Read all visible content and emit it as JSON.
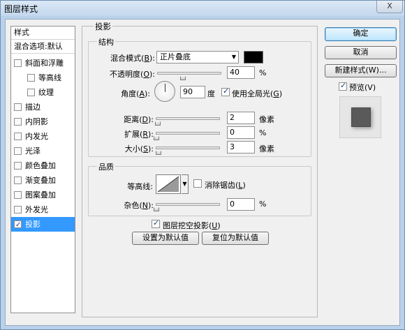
{
  "window": {
    "title": "图层样式",
    "close_label": "X"
  },
  "style_list": {
    "header": "样式",
    "blend_options": "混合选项:默认",
    "items": [
      {
        "label": "斜面和浮雕",
        "checked": false,
        "sub": false
      },
      {
        "label": "等高线",
        "checked": false,
        "sub": true
      },
      {
        "label": "纹理",
        "checked": false,
        "sub": true
      },
      {
        "label": "描边",
        "checked": false,
        "sub": false
      },
      {
        "label": "内阴影",
        "checked": false,
        "sub": false
      },
      {
        "label": "内发光",
        "checked": false,
        "sub": false
      },
      {
        "label": "光泽",
        "checked": false,
        "sub": false
      },
      {
        "label": "颜色叠加",
        "checked": false,
        "sub": false
      },
      {
        "label": "渐变叠加",
        "checked": false,
        "sub": false
      },
      {
        "label": "图案叠加",
        "checked": false,
        "sub": false
      },
      {
        "label": "外发光",
        "checked": false,
        "sub": false
      },
      {
        "label": "投影",
        "checked": true,
        "sub": false,
        "active": true
      }
    ]
  },
  "drop_shadow": {
    "title": "投影",
    "structure": {
      "title": "结构",
      "blend_mode_label": "混合模式(",
      "blend_mode_key": "B",
      "blend_mode_value": "正片叠底",
      "opacity_label": "不透明度(",
      "opacity_key": "O",
      "opacity_value": "40",
      "opacity_unit": "%",
      "angle_label": "角度(",
      "angle_key": "A",
      "angle_value": "90",
      "angle_unit": "度",
      "global_light_label": "使用全局光(",
      "global_light_key": "G",
      "global_light_checked": true,
      "distance_label": "距离(",
      "distance_key": "D",
      "distance_value": "2",
      "distance_unit": "像素",
      "spread_label": "扩展(",
      "spread_key": "R",
      "spread_value": "0",
      "spread_unit": "%",
      "size_label": "大小(",
      "size_key": "S",
      "size_value": "3",
      "size_unit": "像素"
    },
    "quality": {
      "title": "品质",
      "contour_label": "等高线:",
      "antialias_label": "消除锯齿(",
      "antialias_key": "L",
      "antialias_checked": false,
      "noise_label": "杂色(",
      "noise_key": "N",
      "noise_value": "0",
      "noise_unit": "%"
    },
    "knockout_label": "图层挖空投影(",
    "knockout_key": "U",
    "knockout_checked": true,
    "make_default_label": "设置为默认值",
    "reset_default_label": "复位为默认值"
  },
  "side_buttons": {
    "ok_label": "确定",
    "cancel_label": "取消",
    "new_style_label": "新建样式(W)...",
    "preview_label": "预览(V)",
    "preview_checked": true
  },
  "colors": {
    "shadow_color": "#000000",
    "active_item": "#3399ff"
  }
}
